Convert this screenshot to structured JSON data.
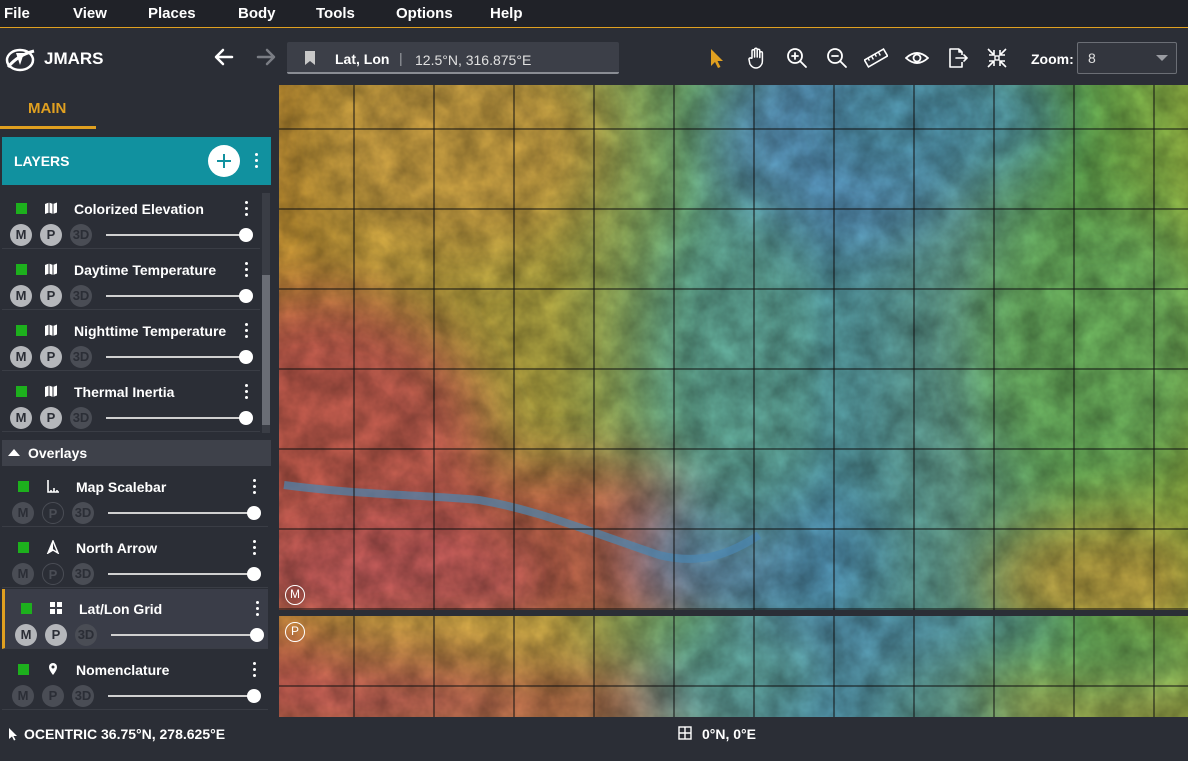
{
  "menu": [
    "File",
    "View",
    "Places",
    "Body",
    "Tools",
    "Options",
    "Help"
  ],
  "app": {
    "title": "JMARS"
  },
  "location": {
    "label": "Lat, Lon",
    "separator": "|",
    "value": "12.5°N, 316.875°E"
  },
  "toolbar": {
    "tools": [
      "pointer-icon",
      "pan-hand-icon",
      "zoom-in-icon",
      "zoom-out-icon",
      "ruler-icon",
      "eye-icon",
      "export-icon",
      "fit-icon"
    ],
    "zoom_label": "Zoom:",
    "zoom_value": "8"
  },
  "sidebar": {
    "tab": "MAIN",
    "layers_title": "LAYERS",
    "layers": [
      {
        "name": "Colorized Elevation",
        "icon": "map-icon"
      },
      {
        "name": "Daytime Temperature",
        "icon": "map-icon"
      },
      {
        "name": "Nighttime Temperature",
        "icon": "map-icon"
      },
      {
        "name": "Thermal Inertia",
        "icon": "map-icon"
      }
    ],
    "overlays_title": "Overlays",
    "overlays": [
      {
        "name": "Map Scalebar",
        "icon": "scalebar-icon"
      },
      {
        "name": "North Arrow",
        "icon": "north-arrow-icon"
      },
      {
        "name": "Lat/Lon Grid",
        "icon": "grid-icon",
        "active": true
      },
      {
        "name": "Nomenclature",
        "icon": "pin-icon"
      }
    ],
    "badges": {
      "m": "M",
      "p": "P",
      "three_d": "3D"
    }
  },
  "map": {
    "main_badge": "M",
    "panner_badge": "P"
  },
  "status": {
    "left": "OCENTRIC  36.75°N, 278.625°E",
    "center": "0°N, 0°E"
  },
  "colors": {
    "accent": "#e0a020",
    "teal": "#11919f",
    "visible": "#1db01d"
  }
}
